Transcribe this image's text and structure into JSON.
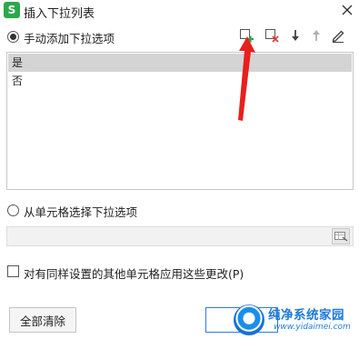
{
  "window": {
    "app_logo_letter": "S",
    "title": "插入下拉列表",
    "close_icon": "close-icon"
  },
  "manual_option": {
    "label": "手动添加下拉选项",
    "checked": true
  },
  "toolbar": {
    "icons": [
      "add-item-icon",
      "delete-item-icon",
      "move-down-icon",
      "move-up-icon",
      "edit-icon"
    ]
  },
  "options_list": {
    "items": [
      "是",
      "否"
    ],
    "selected_index": 0
  },
  "cell_option": {
    "label": "从单元格选择下拉选项",
    "checked": false,
    "range_value": "",
    "range_button_icon": "range-select-icon"
  },
  "apply_all": {
    "label": "对有同样设置的其他单元格应用这些更改(P)",
    "checked": false
  },
  "buttons": {
    "clear_all": "全部清除",
    "ok": ""
  },
  "watermark": {
    "name": "纯净系统家园",
    "url": "www.yidaimei.com"
  },
  "colors": {
    "accent_green": "#2ba84a",
    "delete_red": "#e53935",
    "selection_gray": "#d4d4d4",
    "annotation_red": "#e8201c",
    "watermark_blue": "#1f7ad8"
  }
}
